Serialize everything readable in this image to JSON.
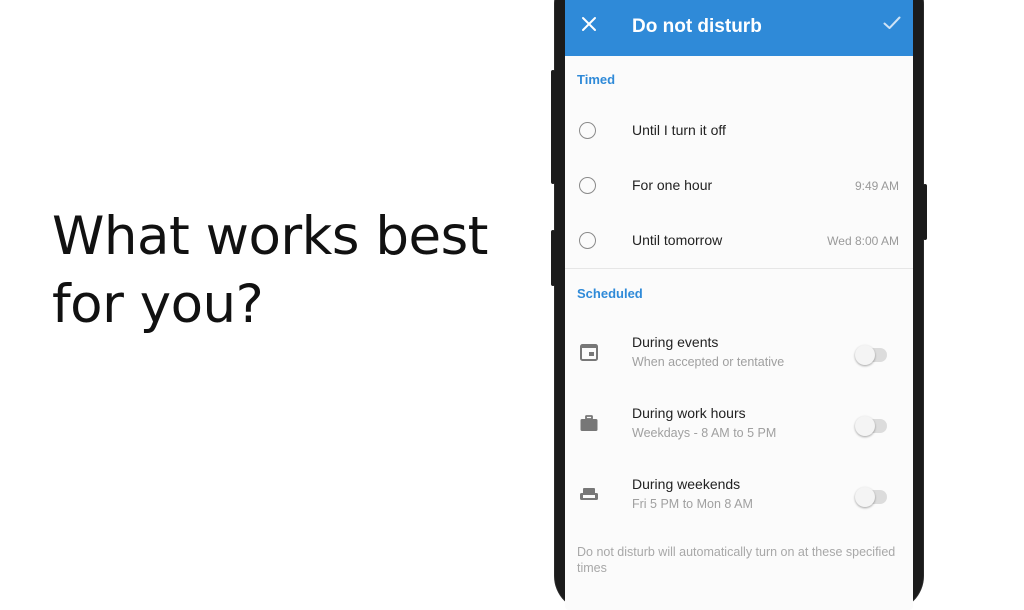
{
  "headline": {
    "line1": "What works best",
    "line2": "for you?"
  },
  "appbar": {
    "title": "Do not disturb",
    "close_icon": "close-icon",
    "confirm_icon": "check-icon",
    "color": "#2f8ad8"
  },
  "timed": {
    "section_label": "Timed",
    "options": [
      {
        "label": "Until I turn it off",
        "meta": ""
      },
      {
        "label": "For one hour",
        "meta": "9:49 AM"
      },
      {
        "label": "Until tomorrow",
        "meta": "Wed 8:00 AM"
      }
    ]
  },
  "scheduled": {
    "section_label": "Scheduled",
    "items": [
      {
        "icon": "calendar-event-icon",
        "title": "During events",
        "subtitle": "When accepted or tentative",
        "enabled": false
      },
      {
        "icon": "briefcase-icon",
        "title": "During work hours",
        "subtitle": "Weekdays - 8 AM to 5 PM",
        "enabled": false
      },
      {
        "icon": "couch-icon",
        "title": "During weekends",
        "subtitle": "Fri 5 PM to Mon 8 AM",
        "enabled": false
      }
    ],
    "footer_note": "Do not disturb will automatically turn on at these specified times"
  }
}
